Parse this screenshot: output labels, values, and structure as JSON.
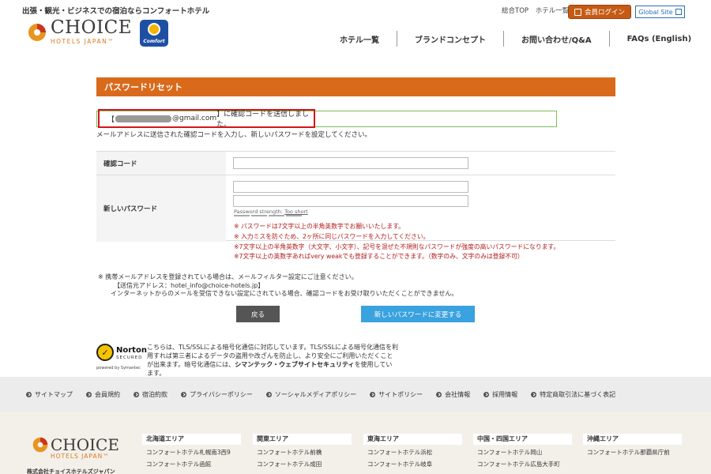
{
  "header": {
    "tagline": "出張・観光・ビジネスでの宿泊ならコンフォートホテル",
    "logo_big": "CHOICE",
    "logo_small": "HOTELS JAPAN™",
    "comfort_label": "Comfort",
    "top_links": [
      "総合TOP",
      "ホテル一覧"
    ],
    "login_label": "会員ログイン",
    "global_label": "Global Site",
    "nav": [
      "ホテル一覧",
      "ブランドコンセプト",
      "お問い合わせ/Q&A",
      "FAQs (English)"
    ]
  },
  "page": {
    "title": "パスワードリセット",
    "sent_prefix": "【",
    "sent_email_suffix": "@gmail.com",
    "sent_suffix": "】に確認コードを送信しました。",
    "description": "メールアドレスに送信された確認コードを入力し、新しいパスワードを設定してください。",
    "code_label": "確認コード",
    "new_password_label": "新しいパスワード",
    "strength_label": "Password strength:",
    "strength_value": "Too short",
    "notes": [
      "※ パスワードは7文字以上の半角英数字でお願いいたします。",
      "※ 入力ミスを防ぐため、2ヶ所に同じパスワードを入力してください。",
      "※7文字以上の半角英数字（大文字、小文字）、記号を混ぜた不規則なパスワードが強度の高いパスワードになります。",
      "※7文字以上の英数字あればvery weakでも登録することができます。（数字のみ、文字のみは登録不可）"
    ],
    "footnote_1": "※ 携帯メールアドレスを登録されている場合は、メールフィルター設定にご注意ください。",
    "footnote_2": "【送信元アドレス：hotel_info@choice-hotels.jp】",
    "footnote_3": "インターネットからのメールを受信できない設定にされている場合、確認コードをお受け取りいただくことができません。",
    "back_button": "戻る",
    "change_button": "新しいパスワードに変更する"
  },
  "security": {
    "badge_name": "Norton",
    "badge_secured": "SECURED",
    "badge_powered": "powered by Symantec",
    "text_1": "こちらは、TLS/SSLによる暗号化通信に対応しています。TLS/SSLによる暗号化通信を利用すれば第三者によるデータの盗用や改ざんを防止し、より安全にご利用いただくことが出来ます。暗号化通信には、",
    "text_bold": "シマンテック・ウェブサイトセキュリティ",
    "text_2": "を使用しています。"
  },
  "footer": {
    "links": [
      "サイトマップ",
      "会員規約",
      "宿泊約款",
      "プライバシーポリシー",
      "ソーシャルメディアポリシー",
      "サイトポリシー",
      "会社情報",
      "採用情報",
      "特定商取引法に基づく表記"
    ],
    "logo_big": "CHOICE",
    "logo_small": "HOTELS JAPAN™",
    "corp": "株式会社チョイスホテルズジャパン",
    "areas": [
      {
        "name": "北海道エリア",
        "items": [
          "コンフォートホテル札幌南3西9",
          "コンフォートホテル函館"
        ]
      },
      {
        "name": "関東エリア",
        "items": [
          "コンフォートホテル前橋",
          "コンフォートホテル成田"
        ]
      },
      {
        "name": "東海エリア",
        "items": [
          "コンフォートホテル浜松",
          "コンフォートホテル岐阜"
        ]
      },
      {
        "name": "中国・四国エリア",
        "items": [
          "コンフォートホテル岡山",
          "コンフォートホテル広島大手町"
        ]
      },
      {
        "name": "沖縄エリア",
        "items": [
          "コンフォートホテル那覇県庁前"
        ]
      }
    ]
  },
  "colors": {
    "accent": "#d96a1c",
    "button_blue": "#3aa2df",
    "highlight_red": "#d4161b"
  }
}
